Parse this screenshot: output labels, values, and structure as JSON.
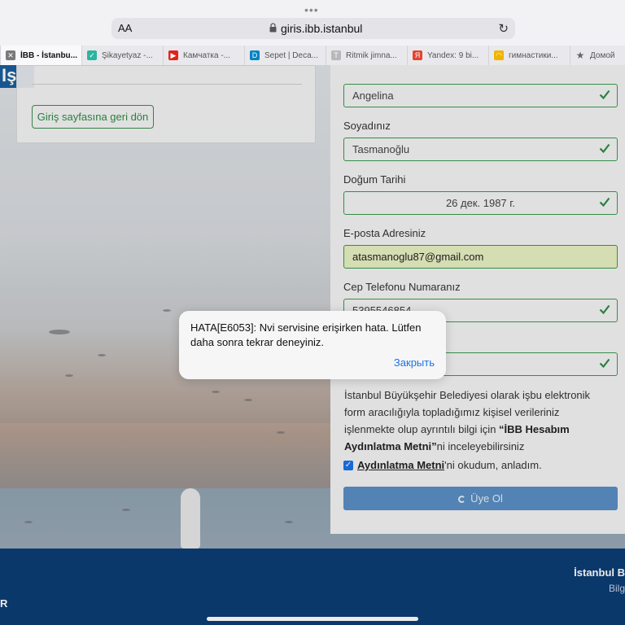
{
  "browser": {
    "aa_label": "AA",
    "url": "giris.ibb.istanbul",
    "tabs": [
      {
        "title": "İBB - İstanbu...",
        "icon": "close-icon",
        "active": true
      },
      {
        "title": "Şikayetyaz -...",
        "icon": "bird-favicon-icon",
        "active": false
      },
      {
        "title": "Камчатка -...",
        "icon": "youtube-icon",
        "active": false
      },
      {
        "title": "Sepet | Deca...",
        "icon": "decathlon-icon",
        "active": false
      },
      {
        "title": "Ritmik jimna...",
        "icon": "t-favicon-icon",
        "active": false
      },
      {
        "title": "Yandex: 9 bi...",
        "icon": "yandex-icon",
        "active": false
      },
      {
        "title": "гимнастики...",
        "icon": "face-favicon-icon",
        "active": false
      },
      {
        "title": "Домой",
        "icon": "star-icon",
        "active": false
      }
    ]
  },
  "page": {
    "logo_text": "Iş",
    "back_button": "Giriş sayfasına geri dön",
    "fields": [
      {
        "label": "",
        "value": "Angelina"
      },
      {
        "label": "Soyadınız",
        "value": "Tasmanoğlu"
      },
      {
        "label": "Doğum Tarihi",
        "value": "26 дек. 1987 г."
      },
      {
        "label": "E-posta Adresiniz",
        "value": "atasmanoglu87@gmail.com"
      },
      {
        "label": "Cep Telefonu Numaranız",
        "value": "5395546854"
      },
      {
        "label": "",
        "value": ""
      }
    ],
    "notice_text": "İstanbul Büyükşehir Belediyesi olarak işbu elektronik form aracılığıyla topladığımız kişisel verileriniz işlenmekte olup ayrıntılı bilgi için ",
    "notice_bold": "“İBB Hesabım Aydınlatma Metni”",
    "notice_tail": "ni inceleyebilirsiniz",
    "agree_link": "Aydınlatma Metni",
    "agree_tail": "'ni okudum, anladım.",
    "submit_label": "Üye Ol"
  },
  "footer": {
    "line1": "İstanbul B",
    "line2": "Bilg",
    "line3": "R"
  },
  "alert": {
    "message": "HATA[E6053]: Nvi servisine erişirken hata. Lütfen daha sonra tekrar deneyiniz.",
    "button": "Закрыть"
  },
  "colors": {
    "accent": "#1a73e8",
    "valid": "#3a9b4f",
    "footer": "#0c3d73",
    "submit": "#5a8fc4"
  }
}
